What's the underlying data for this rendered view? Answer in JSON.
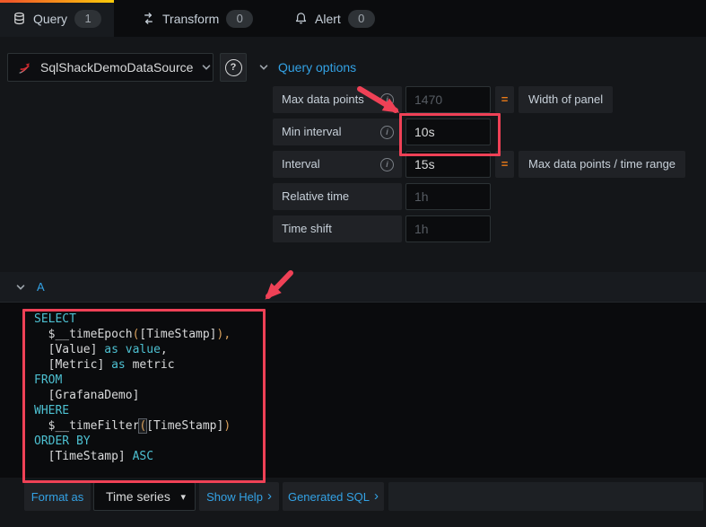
{
  "colors": {
    "accent_blue": "#33a2e5",
    "equals_orange": "#eb7b18",
    "annotation_red": "#ef4156",
    "sql_keyword": "#4dc0d1",
    "sql_orange": "#d9a15d",
    "tab_gradient_start": "#f05a28",
    "tab_gradient_end": "#fbca0a"
  },
  "tabs": [
    {
      "label": "Query",
      "count": "1",
      "icon": "database-icon",
      "active": true
    },
    {
      "label": "Transform",
      "count": "0",
      "icon": "transform-icon",
      "active": false
    },
    {
      "label": "Alert",
      "count": "0",
      "icon": "bell-icon",
      "active": false
    }
  ],
  "toolbar": {
    "datasource_name": "SqlShackDemoDataSource",
    "datasource_icon": "sqlserver-icon",
    "help_label": "?",
    "query_options_label": "Query options"
  },
  "query_options": {
    "rows": [
      {
        "label": "Max data points",
        "info": true,
        "value": "",
        "placeholder": "1470",
        "equals": "=",
        "note": "Width of panel",
        "highlight": false
      },
      {
        "label": "Min interval",
        "info": true,
        "value": "10s",
        "placeholder": "",
        "equals": "",
        "note": "",
        "highlight": true
      },
      {
        "label": "Interval",
        "info": true,
        "value": "15s",
        "placeholder": "",
        "equals": "=",
        "note": "Max data points / time range",
        "highlight": false
      },
      {
        "label": "Relative time",
        "info": false,
        "value": "",
        "placeholder": "1h",
        "equals": "",
        "note": "",
        "highlight": false
      },
      {
        "label": "Time shift",
        "info": false,
        "value": "",
        "placeholder": "1h",
        "equals": "",
        "note": "",
        "highlight": false
      }
    ]
  },
  "query_row": {
    "label": "A"
  },
  "sql_editor": {
    "lines": [
      [
        {
          "t": "SELECT",
          "c": "kw"
        }
      ],
      [
        {
          "t": "  $__timeEpoch",
          "c": "pl"
        },
        {
          "t": "(",
          "c": "or"
        },
        {
          "t": "[TimeStamp]",
          "c": "pl"
        },
        {
          "t": "),",
          "c": "or"
        }
      ],
      [
        {
          "t": "  [Value] ",
          "c": "pl"
        },
        {
          "t": "as",
          "c": "kw"
        },
        {
          "t": " ",
          "c": "pl"
        },
        {
          "t": "value",
          "c": "kw"
        },
        {
          "t": ",",
          "c": "pl"
        }
      ],
      [
        {
          "t": "  [Metric] ",
          "c": "pl"
        },
        {
          "t": "as",
          "c": "kw"
        },
        {
          "t": " metric",
          "c": "pl"
        }
      ],
      [
        {
          "t": "FROM",
          "c": "kw"
        }
      ],
      [
        {
          "t": "  [GrafanaDemo]",
          "c": "pl"
        }
      ],
      [
        {
          "t": "WHERE",
          "c": "kw"
        }
      ],
      [
        {
          "t": "  $__timeFilter",
          "c": "pl"
        },
        {
          "t": "(",
          "c": "or match"
        },
        {
          "t": "[TimeStamp]",
          "c": "pl"
        },
        {
          "t": ")",
          "c": "or"
        }
      ],
      [
        {
          "t": "ORDER BY",
          "c": "kw"
        }
      ],
      [
        {
          "t": "  [TimeStamp] ",
          "c": "pl"
        },
        {
          "t": "ASC",
          "c": "kw"
        }
      ]
    ]
  },
  "footer": {
    "format_as": "Format as",
    "format_value": "Time series",
    "show_help": "Show Help",
    "generated_sql": "Generated SQL",
    "chevron": "›",
    "caret": "▾"
  }
}
